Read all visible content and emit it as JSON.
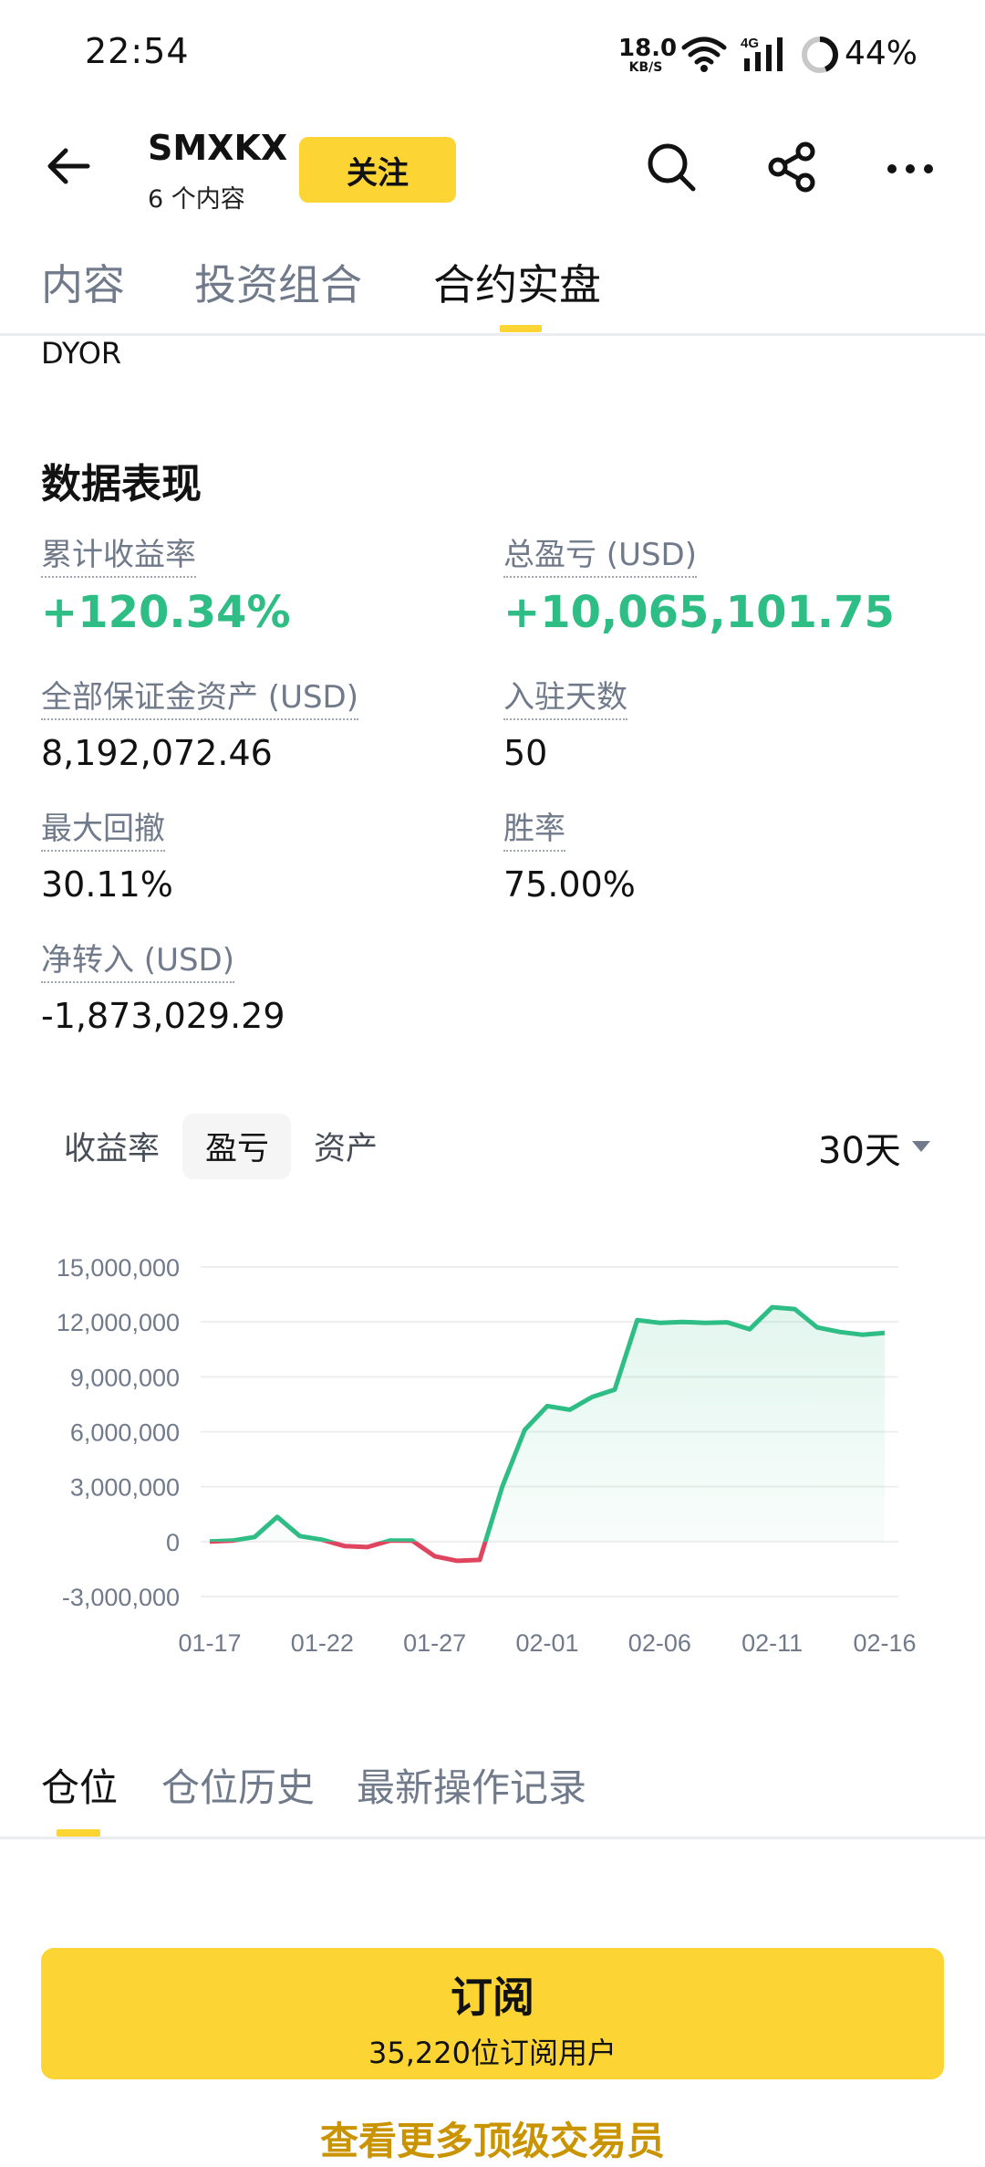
{
  "status_bar": {
    "time": "22:54",
    "net_speed_value": "18.0",
    "net_speed_unit": "KB/S",
    "network_type": "4G",
    "battery_percent": "44%",
    "battery_level": 0.44
  },
  "header": {
    "title": "SMXKX",
    "subtitle": "6 个内容",
    "follow_label": "关注",
    "icons": [
      "back-arrow-icon",
      "search-icon",
      "share-icon",
      "more-icon"
    ]
  },
  "top_tabs": [
    {
      "label": "内容",
      "active": false
    },
    {
      "label": "投资组合",
      "active": false
    },
    {
      "label": "合约实盘",
      "active": true
    }
  ],
  "dyor_text": "DYOR",
  "performance": {
    "title": "数据表现",
    "cumulative_return": {
      "label": "累计收益率",
      "value": "+120.34%"
    },
    "total_pnl": {
      "label": "总盈亏 (USD)",
      "value": "+10,065,101.75"
    },
    "total_margin": {
      "label": "全部保证金资产 (USD)",
      "value": "8,192,072.46"
    },
    "days": {
      "label": "入驻天数",
      "value": "50"
    },
    "max_drawdown": {
      "label": "最大回撤",
      "value": "30.11%"
    },
    "win_rate": {
      "label": "胜率",
      "value": "75.00%"
    },
    "net_transfer": {
      "label": "净转入 (USD)",
      "value": "-1,873,029.29"
    }
  },
  "chart_tabs": [
    {
      "label": "收益率",
      "active": false
    },
    {
      "label": "盈亏",
      "active": true
    },
    {
      "label": "资产",
      "active": false
    }
  ],
  "period": "30天",
  "colors": {
    "positive": "#2ebd85",
    "negative": "#e0455f",
    "brand": "#fcd535",
    "link": "#c99400"
  },
  "chart_data": {
    "type": "area",
    "title": "",
    "xlabel": "",
    "ylabel": "",
    "x_tick_labels": [
      "01-17",
      "01-22",
      "01-27",
      "02-01",
      "02-06",
      "02-11",
      "02-16"
    ],
    "y_tick_labels": [
      "15,000,000",
      "12,000,000",
      "9,000,000",
      "6,000,000",
      "3,000,000",
      "0",
      "-3,000,000"
    ],
    "y_ticks": [
      15000000,
      12000000,
      9000000,
      6000000,
      3000000,
      0,
      -3000000
    ],
    "ylim": [
      -3000000,
      15000000
    ],
    "grid": true,
    "x": [
      "01-17",
      "01-18",
      "01-19",
      "01-20",
      "01-21",
      "01-22",
      "01-23",
      "01-24",
      "01-25",
      "01-26",
      "01-27",
      "01-28",
      "01-29",
      "01-30",
      "01-31",
      "02-01",
      "02-02",
      "02-03",
      "02-04",
      "02-05",
      "02-06",
      "02-07",
      "02-08",
      "02-09",
      "02-10",
      "02-11",
      "02-12",
      "02-13",
      "02-14",
      "02-15",
      "02-16"
    ],
    "series": [
      {
        "values": [
          0,
          50000,
          250000,
          1350000,
          300000,
          100000,
          -250000,
          -300000,
          50000,
          50000,
          -800000,
          -1050000,
          -1000000,
          3000000,
          6100000,
          7400000,
          7200000,
          7900000,
          8300000,
          12100000,
          11950000,
          12000000,
          11950000,
          11980000,
          11600000,
          12800000,
          12700000,
          11700000,
          11450000,
          11300000,
          11400000
        ]
      }
    ]
  },
  "bottom_tabs": [
    {
      "label": "仓位",
      "active": true
    },
    {
      "label": "仓位历史",
      "active": false
    },
    {
      "label": "最新操作记录",
      "active": false
    }
  ],
  "subscribe": {
    "label": "订阅",
    "count_text": "35,220位订阅用户"
  },
  "more_traders_link": "查看更多顶级交易员"
}
